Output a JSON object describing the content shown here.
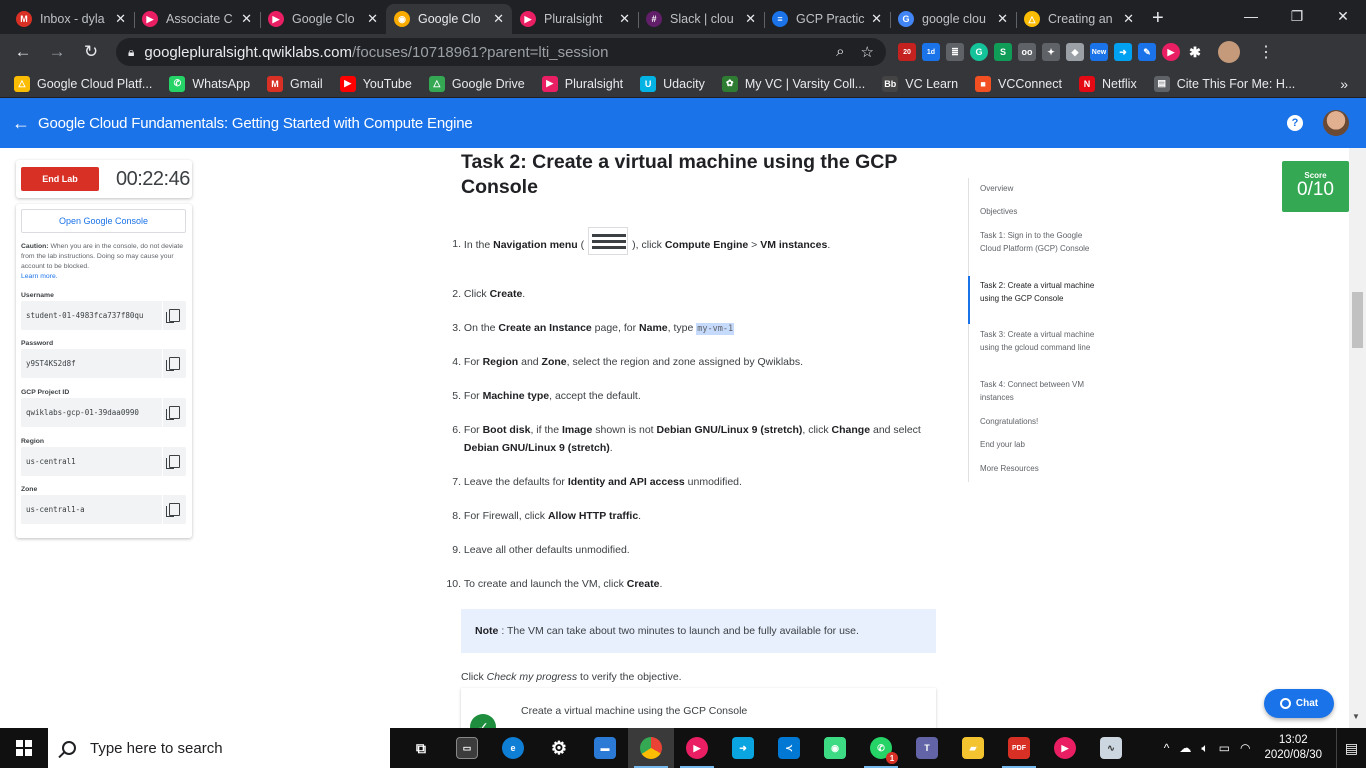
{
  "browser": {
    "tabs": [
      {
        "label": "Inbox - dyla",
        "color": "#d93025",
        "glyph": "M",
        "active": false
      },
      {
        "label": "Associate C",
        "color": "#e91e63",
        "glyph": "▶",
        "active": false
      },
      {
        "label": "Google Clo",
        "color": "#e91e63",
        "glyph": "▶",
        "active": false
      },
      {
        "label": "Google Clo",
        "color": "#f9ab00",
        "glyph": "◉",
        "active": true
      },
      {
        "label": "Pluralsight",
        "color": "#e91e63",
        "glyph": "▶",
        "active": false
      },
      {
        "label": "Slack | clou",
        "color": "#611f69",
        "glyph": "#",
        "active": false
      },
      {
        "label": "GCP Practic",
        "color": "#1a73e8",
        "glyph": "≡",
        "active": false
      },
      {
        "label": "google clou",
        "color": "#4285f4",
        "glyph": "G",
        "active": false
      },
      {
        "label": "Creating an",
        "color": "#fbbc04",
        "glyph": "△",
        "active": false
      }
    ],
    "url_host": "googlepluralsight.qwiklabs.com",
    "url_path": "/focuses/10718961?parent=lti_session",
    "extension_badges": {
      "first": "20",
      "second": "1d",
      "third": "New"
    },
    "bookmarks": [
      {
        "label": "Google Cloud Platf...",
        "color": "#fbbc04",
        "glyph": "△"
      },
      {
        "label": "WhatsApp",
        "color": "#25d366",
        "glyph": "✆"
      },
      {
        "label": "Gmail",
        "color": "#d93025",
        "glyph": "M"
      },
      {
        "label": "YouTube",
        "color": "#ff0000",
        "glyph": "▶"
      },
      {
        "label": "Google Drive",
        "color": "#34a853",
        "glyph": "△"
      },
      {
        "label": "Pluralsight",
        "color": "#e91e63",
        "glyph": "▶"
      },
      {
        "label": "Udacity",
        "color": "#02b3e4",
        "glyph": "U"
      },
      {
        "label": "My VC | Varsity Coll...",
        "color": "#2e7d32",
        "glyph": "✿"
      },
      {
        "label": "VC Learn",
        "color": "#444444",
        "glyph": "Bb"
      },
      {
        "label": "VCConnect",
        "color": "#f25022",
        "glyph": "■"
      },
      {
        "label": "Netflix",
        "color": "#e50914",
        "glyph": "N"
      },
      {
        "label": "Cite This For Me: H...",
        "color": "#5f6368",
        "glyph": "▤"
      }
    ]
  },
  "appbar": {
    "title": "Google Cloud Fundamentals: Getting Started with Compute Engine",
    "help_glyph": "?"
  },
  "lab": {
    "end_label": "End Lab",
    "timer": "00:22:46",
    "open_console_label": "Open Google Console",
    "caution_label": "Caution:",
    "caution_text": "When you are in the console, do not deviate from the lab instructions. Doing so may cause your account to be blocked.",
    "learn_more": "Learn more.",
    "fields": [
      {
        "label": "Username",
        "value": "student-01-4983fca737f80qu"
      },
      {
        "label": "Password",
        "value": "y9ST4KS2d8f"
      },
      {
        "label": "GCP Project ID",
        "value": "qwiklabs-gcp-01-39daa0990"
      },
      {
        "label": "Region",
        "value": "us-central1"
      },
      {
        "label": "Zone",
        "value": "us-central1-a"
      }
    ]
  },
  "task": {
    "title": "Task 2: Create a virtual machine using the GCP Console",
    "steps": {
      "s1": {
        "num": "1.",
        "a": "In the ",
        "b": "Navigation menu",
        "c": " (",
        "d": "), click ",
        "e": "Compute Engine",
        "f": " > ",
        "g": "VM instances",
        "h": "."
      },
      "s2": {
        "num": "2.",
        "a": "Click ",
        "b": "Create",
        "c": "."
      },
      "s3": {
        "num": "3.",
        "a": "On the ",
        "b": "Create an Instance",
        "c": " page, for ",
        "d": "Name",
        "e": ", type ",
        "code": "my-vm-1"
      },
      "s4": {
        "num": "4.",
        "a": "For ",
        "b": "Region",
        "c": " and ",
        "d": "Zone",
        "e": ", select the region and zone assigned by Qwiklabs."
      },
      "s5": {
        "num": "5.",
        "a": "For ",
        "b": "Machine type",
        "c": ", accept the default."
      },
      "s6": {
        "num": "6.",
        "a": "For ",
        "b": "Boot disk",
        "c": ", if the ",
        "d": "Image",
        "e": " shown is not ",
        "f": "Debian GNU/Linux 9 (stretch)",
        "g": ", click ",
        "h": "Change",
        "i": " and select ",
        "j": "Debian GNU/Linux 9 (stretch)",
        "k": "."
      },
      "s7": {
        "num": "7.",
        "a": "Leave the defaults for ",
        "b": "Identity and API access",
        "c": " unmodified."
      },
      "s8": {
        "num": "8.",
        "a": "For Firewall, click ",
        "b": "Allow HTTP traffic",
        "c": "."
      },
      "s9": {
        "num": "9.",
        "a": "Leave all other defaults unmodified."
      },
      "s10": {
        "num": "10.",
        "a": "To create and launch the VM, click ",
        "b": "Create",
        "c": "."
      }
    },
    "note_label": "Note",
    "note_text": ": The VM can take about two minutes to launch and be fully available for use.",
    "progress_a": "Click ",
    "progress_link": "Check my progress",
    "progress_b": " to verify the objective.",
    "check_title": "Create a virtual machine using the GCP Console"
  },
  "toc": [
    "Overview",
    "Objectives",
    "Task 1: Sign in to the Google Cloud Platform (GCP) Console",
    "Task 2: Create a virtual machine using the GCP Console",
    "Task 3: Create a virtual machine using the gcloud command line",
    "Task 4: Connect between VM instances",
    "Congratulations!",
    "End your lab",
    "More Resources"
  ],
  "score": {
    "label": "Score",
    "value": "0/10"
  },
  "chat_label": "Chat",
  "taskbar": {
    "search_placeholder": "Type here to search",
    "time": "13:02",
    "date": "2020/08/30",
    "whatsapp_badge": "1"
  }
}
